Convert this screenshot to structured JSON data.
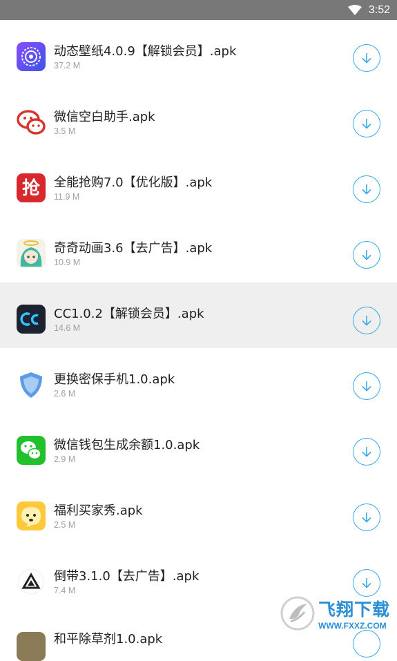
{
  "status_bar": {
    "time": "3:52"
  },
  "items": [
    {
      "name": "动态壁纸4.0.9【解锁会员】.apk",
      "size": "37.2 M",
      "icon": "dynamic-wallpaper-icon"
    },
    {
      "name": "微信空白助手.apk",
      "size": "3.5 M",
      "icon": "wechat-outline-icon"
    },
    {
      "name": "全能抢购7.0【优化版】.apk",
      "size": "11.9 M",
      "icon": "qiang-icon",
      "icon_text": "抢"
    },
    {
      "name": "奇奇动画3.6【去广告】.apk",
      "size": "10.9 M",
      "icon": "anime-girl-icon"
    },
    {
      "name": "CC1.0.2【解锁会员】.apk",
      "size": "14.6 M",
      "icon": "cc-icon",
      "selected": true
    },
    {
      "name": "更换密保手机1.0.apk",
      "size": "2.6 M",
      "icon": "shield-icon"
    },
    {
      "name": "微信钱包生成余额1.0.apk",
      "size": "2.9 M",
      "icon": "wechat-icon"
    },
    {
      "name": "福利买家秀.apk",
      "size": "2.5 M",
      "icon": "smiley-icon"
    },
    {
      "name": "倒带3.1.0【去广告】.apk",
      "size": "7.4 M",
      "icon": "triangle-logo-icon"
    }
  ],
  "partial_item": {
    "name": "和平除草剂1.0.apk"
  },
  "watermark": {
    "title": "飞翔下载",
    "url": "WWW.FXXZ.COM"
  },
  "colors": {
    "accent": "#38a8e6",
    "status_bar": "#787878",
    "selected_row": "#efefef"
  }
}
